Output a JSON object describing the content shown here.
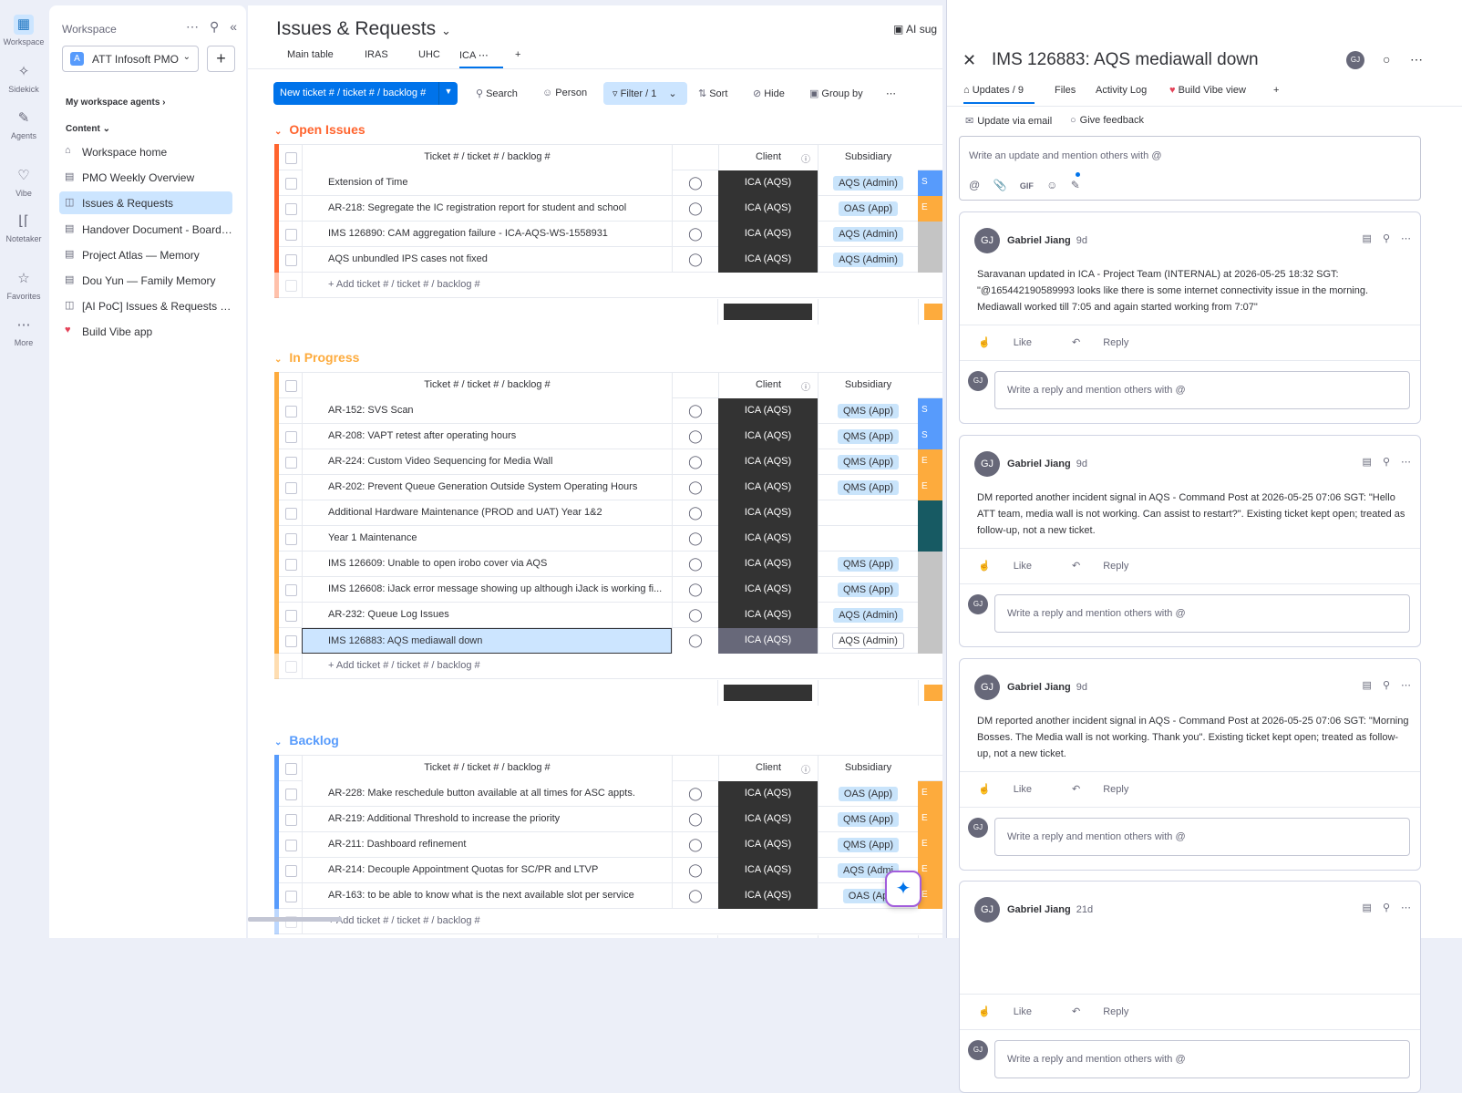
{
  "rail": [
    {
      "label": "Workspace",
      "icon": "grid-icon"
    },
    {
      "label": "Sidekick",
      "icon": "sparkle-icon"
    },
    {
      "label": "Agents",
      "icon": "agent-icon"
    },
    {
      "label": "Vibe",
      "icon": "heart-icon"
    },
    {
      "label": "Notetaker",
      "icon": "audio-icon"
    },
    {
      "label": "Favorites",
      "icon": "star-icon"
    },
    {
      "label": "More",
      "icon": "more-icon"
    }
  ],
  "sidebar": {
    "title": "Workspace",
    "workspace": "ATT Infosoft PMO",
    "workspace_badge": "A",
    "agents_label": "My workspace agents",
    "content_label": "Content",
    "items": [
      {
        "label": "Workspace home"
      },
      {
        "label": "PMO Weekly Overview"
      },
      {
        "label": "Issues & Requests"
      },
      {
        "label": "Handover Document - Board Mi..."
      },
      {
        "label": "Project Atlas — Memory"
      },
      {
        "label": "Dou Yun — Family Memory"
      },
      {
        "label": "[AI PoC] Issues & Requests — ..."
      },
      {
        "label": "Build Vibe app"
      }
    ]
  },
  "board": {
    "title": "Issues & Requests",
    "ai_label": "AI sug",
    "tabs": [
      "Main table",
      "IRAS",
      "UHC",
      "ICA",
      "+"
    ],
    "new_button": "New ticket # / ticket # / backlog #",
    "toolbar": {
      "search": "Search",
      "person": "Person",
      "filter": "Filter / 1",
      "sort": "Sort",
      "hide": "Hide",
      "group_by": "Group by"
    },
    "columns": {
      "name": "Ticket # / ticket # / backlog #",
      "client": "Client",
      "subsidiary": "Subsidiary"
    },
    "add_row": "+ Add ticket # / ticket # / backlog #"
  },
  "groups": [
    {
      "title": "Open Issues",
      "color": "#ff642e",
      "title_color": "#ff642e",
      "rows": [
        {
          "name": "Extension of Time",
          "client": "ICA (AQS)",
          "subsidiary": "AQS (Admin)",
          "status_color": "#579bfc",
          "status_text": "S"
        },
        {
          "name": "AR-218: Segregate the IC registration report for student and school",
          "client": "ICA (AQS)",
          "subsidiary": "OAS (App)",
          "status_color": "#fdab3d",
          "status_text": "E"
        },
        {
          "name": "IMS 126890: CAM aggregation failure - ICA-AQS-WS-1558931",
          "client": "ICA (AQS)",
          "subsidiary": "AQS (Admin)",
          "status_color": "#c4c4c4",
          "status_text": ""
        },
        {
          "name": "AQS unbundled IPS cases not fixed",
          "client": "ICA (AQS)",
          "subsidiary": "AQS (Admin)",
          "status_color": "#c4c4c4",
          "status_text": ""
        }
      ]
    },
    {
      "title": "In Progress",
      "color": "#fdab3d",
      "title_color": "#fdab3d",
      "rows": [
        {
          "name": "AR-152: SVS Scan",
          "client": "ICA (AQS)",
          "subsidiary": "QMS (App)",
          "status_color": "#579bfc",
          "status_text": "S"
        },
        {
          "name": "AR-208: VAPT retest after operating hours",
          "client": "ICA (AQS)",
          "subsidiary": "QMS (App)",
          "status_color": "#579bfc",
          "status_text": "S"
        },
        {
          "name": "AR-224: Custom Video Sequencing for Media Wall",
          "client": "ICA (AQS)",
          "subsidiary": "QMS (App)",
          "status_color": "#fdab3d",
          "status_text": "E"
        },
        {
          "name": "AR-202: Prevent Queue Generation Outside System Operating Hours",
          "client": "ICA (AQS)",
          "subsidiary": "QMS (App)",
          "status_color": "#fdab3d",
          "status_text": "E"
        },
        {
          "name": "Additional Hardware Maintenance (PROD and UAT) Year 1&2",
          "client": "ICA (AQS)",
          "subsidiary": "",
          "status_color": "#175a63",
          "status_text": ""
        },
        {
          "name": "Year 1 Maintenance",
          "client": "ICA (AQS)",
          "subsidiary": "",
          "status_color": "#175a63",
          "status_text": ""
        },
        {
          "name": "IMS 126609: Unable to open irobo cover via AQS",
          "client": "ICA (AQS)",
          "subsidiary": "QMS (App)",
          "status_color": "#c4c4c4",
          "status_text": ""
        },
        {
          "name": "IMS 126608: iJack error message showing up although iJack is working fi...",
          "client": "ICA (AQS)",
          "subsidiary": "QMS (App)",
          "status_color": "#c4c4c4",
          "status_text": ""
        },
        {
          "name": "AR-232: Queue Log Issues",
          "client": "ICA (AQS)",
          "subsidiary": "AQS (Admin)",
          "status_color": "#c4c4c4",
          "status_text": ""
        },
        {
          "name": "IMS 126883: AQS mediawall down",
          "client": "ICA (AQS)",
          "subsidiary": "AQS (Admin)",
          "status_color": "#c4c4c4",
          "status_text": "",
          "selected": true
        }
      ]
    },
    {
      "title": "Backlog",
      "color": "#579bfc",
      "title_color": "#579bfc",
      "rows": [
        {
          "name": "AR-228: Make reschedule button available at all times for ASC appts.",
          "client": "ICA (AQS)",
          "subsidiary": "OAS (App)",
          "status_color": "#fdab3d",
          "status_text": "E"
        },
        {
          "name": "AR-219: Additional Threshold to increase the priority",
          "client": "ICA (AQS)",
          "subsidiary": "QMS (App)",
          "status_color": "#fdab3d",
          "status_text": "E"
        },
        {
          "name": "AR-211: Dashboard refinement",
          "client": "ICA (AQS)",
          "subsidiary": "QMS (App)",
          "status_color": "#fdab3d",
          "status_text": "E"
        },
        {
          "name": "AR-214: Decouple Appointment Quotas for SC/PR and LTVP",
          "client": "ICA (AQS)",
          "subsidiary": "AQS (Admi",
          "status_color": "#fdab3d",
          "status_text": "E"
        },
        {
          "name": "AR-163: to be able to know what is the next available slot per service",
          "client": "ICA (AQS)",
          "subsidiary": "OAS (Ap",
          "status_color": "#fdab3d",
          "status_text": "E"
        }
      ]
    }
  ],
  "panel": {
    "title": "IMS 126883: AQS mediawall down",
    "avatar": "GJ",
    "tabs": [
      "Updates / 9",
      "Files",
      "Activity Log",
      "Build Vibe view",
      "+"
    ],
    "update_email": "Update via email",
    "feedback": "Give feedback",
    "composer_placeholder": "Write an update and mention others with @",
    "composer_tools": [
      "@",
      "📎",
      "GIF",
      "☺",
      "✎"
    ],
    "like": "Like",
    "reply": "Reply",
    "reply_placeholder": "Write a reply and mention others with @",
    "updates": [
      {
        "author": "Gabriel Jiang",
        "initials": "GJ",
        "time": "9d",
        "body": "Saravanan updated in ICA - Project Team (INTERNAL) at 2026-05-25 18:32 SGT: \"@165442190589993 looks like there is some internet connectivity issue in the morning. Mediawall worked till 7:05 and again started working from 7:07\""
      },
      {
        "author": "Gabriel Jiang",
        "initials": "GJ",
        "time": "9d",
        "body": "DM reported another incident signal in AQS - Command Post at 2026-05-25 07:06 SGT: \"Hello ATT team, media wall is not working. Can assist to restart?\". Existing ticket kept open; treated as follow-up, not a new ticket."
      },
      {
        "author": "Gabriel Jiang",
        "initials": "GJ",
        "time": "9d",
        "body": "DM reported another incident signal in AQS - Command Post at 2026-05-25 07:06 SGT: \"Morning Bosses. The Media wall is not working. Thank you\". Existing ticket kept open; treated as follow-up, not a new ticket."
      },
      {
        "author": "Gabriel Jiang",
        "initials": "GJ",
        "time": "21d",
        "body": ""
      }
    ]
  }
}
